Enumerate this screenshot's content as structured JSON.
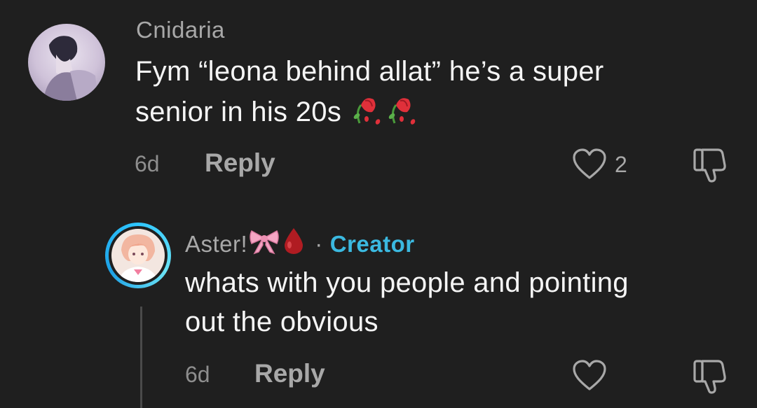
{
  "comment1": {
    "username": "Cnidaria",
    "text_line1": "Fym “leona behind allat” he’s a super",
    "text_line2": "senior in his 20s",
    "time": "6d",
    "reply_label": "Reply",
    "like_count": "2",
    "trailing_emoji": "wilted-rose-emoji x2"
  },
  "comment2": {
    "username": "Aster!",
    "username_emoji": "ribbon-emoji, blood-drop-emoji",
    "separator": "·",
    "badge": "Creator",
    "text_line1": "whats with you people and pointing",
    "text_line2": "out the obvious",
    "time": "6d",
    "reply_label": "Reply"
  },
  "colors": {
    "background": "#1f1f1f",
    "text_primary": "#f5f5f5",
    "text_secondary": "#a8a8a8",
    "creator_accent": "#3bb9e0"
  }
}
